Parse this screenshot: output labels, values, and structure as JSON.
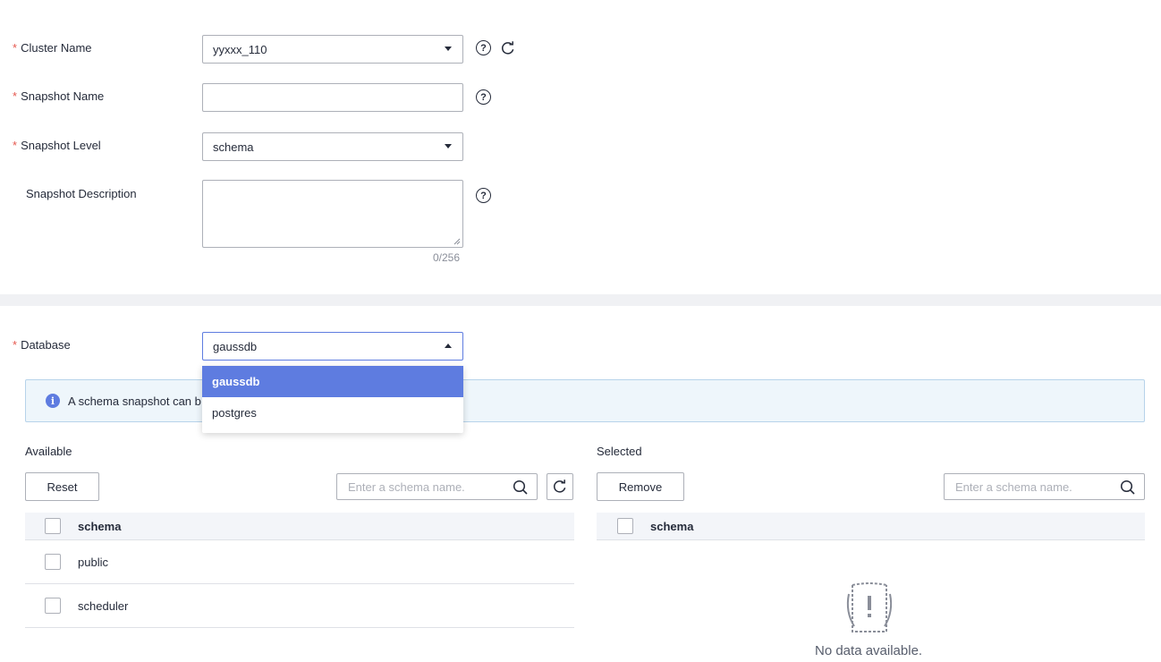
{
  "form": {
    "cluster_name": {
      "label": "Cluster Name",
      "value": "yyxxx_110"
    },
    "snapshot_name": {
      "label": "Snapshot Name",
      "value": ""
    },
    "snapshot_level": {
      "label": "Snapshot Level",
      "value": "schema"
    },
    "snapshot_description": {
      "label": "Snapshot Description",
      "value": "",
      "counter": "0/256"
    },
    "required_mark": "*",
    "help_glyph": "?"
  },
  "database": {
    "label": "Database",
    "value": "gaussdb",
    "options": [
      "gaussdb",
      "postgres"
    ],
    "selected_option": "gaussdb"
  },
  "info": {
    "glyph": "i",
    "text": "A schema snapshot can b"
  },
  "available": {
    "title": "Available",
    "reset_label": "Reset",
    "search_placeholder": "Enter a schema name.",
    "column_header": "schema",
    "rows": [
      "public",
      "scheduler"
    ]
  },
  "selected": {
    "title": "Selected",
    "remove_label": "Remove",
    "search_placeholder": "Enter a schema name.",
    "column_header": "schema",
    "empty_text": "No data available."
  },
  "colors": {
    "accent": "#5e7ce0",
    "required": "#e5584f",
    "info_bg": "#eef6fb",
    "divider": "#f0f1f4"
  },
  "icons": {
    "help": "help-circle-icon",
    "refresh": "refresh-icon",
    "search": "search-icon",
    "info": "info-icon",
    "empty": "empty-data-icon",
    "dropdown": "chevron-down-icon"
  }
}
